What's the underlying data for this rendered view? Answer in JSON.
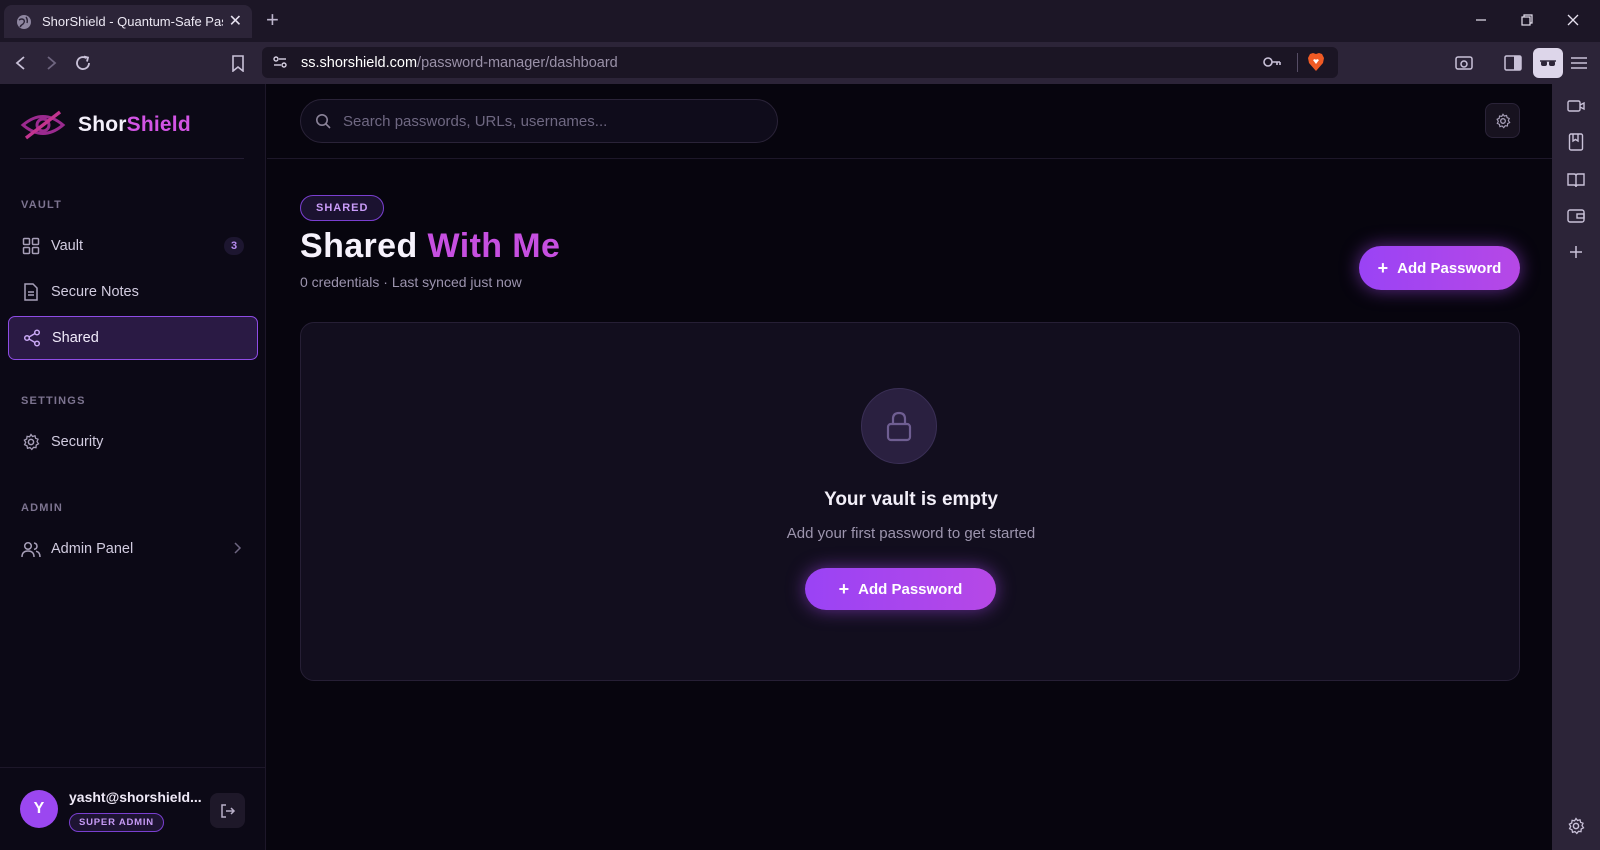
{
  "browser": {
    "tab_title": "ShorShield - Quantum-Safe Pass",
    "url_host": "ss.shorshield.com",
    "url_path": "/password-manager/dashboard"
  },
  "sidebar": {
    "brand_part1": "Shor",
    "brand_part2": "Shield",
    "sections": {
      "vault": "VAULT",
      "settings": "SETTINGS",
      "admin": "ADMIN"
    },
    "items": [
      {
        "label": "Vault",
        "badge": "3",
        "icon": "grid-icon"
      },
      {
        "label": "Secure Notes",
        "icon": "note-icon"
      },
      {
        "label": "Shared",
        "icon": "share-icon",
        "active": true
      },
      {
        "label": "Security",
        "icon": "gear-icon"
      },
      {
        "label": "Admin Panel",
        "icon": "users-icon"
      }
    ],
    "user": {
      "avatar_letter": "Y",
      "email": "yasht@shorshield...",
      "role": "SUPER ADMIN"
    }
  },
  "header": {
    "search_placeholder": "Search passwords, URLs, usernames..."
  },
  "page": {
    "pill": "SHARED",
    "title_part1": "Shared",
    "title_part2": "With Me",
    "subtitle": "0 credentials · Last synced just now",
    "add_button": "Add Password"
  },
  "empty_state": {
    "title": "Your vault is empty",
    "subtitle": "Add your first password to get started",
    "button": "Add Password"
  },
  "colors": {
    "accent": "#9a43f5",
    "brand_pink": "#c64fe0",
    "background": "#07050e"
  }
}
